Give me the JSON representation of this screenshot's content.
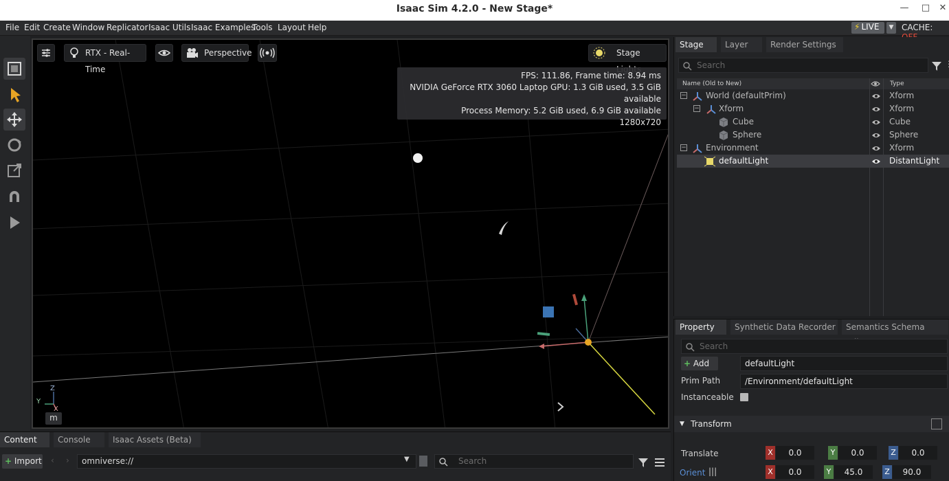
{
  "window": {
    "title": "Isaac Sim 4.2.0 - New Stage*",
    "minimize_glyph": "—",
    "maximize_glyph": "□",
    "close_glyph": "✕"
  },
  "menu": [
    "File",
    "Edit",
    "Create",
    "Window",
    "Replicator",
    "Isaac Utils",
    "Isaac Examples",
    "Tools",
    "Layout",
    "Help"
  ],
  "live": {
    "label": "LIVE",
    "cache_label": "CACHE:",
    "cache_state": "OFF"
  },
  "viewport": {
    "renderer_label": "RTX - Real-Time",
    "camera_label": "Perspective",
    "lights_label": "Stage Lights",
    "stats": [
      "FPS: 111.86, Frame time: 8.94 ms",
      "NVIDIA GeForce RTX 3060 Laptop GPU: 1.3 GiB used, 3.5 GiB available",
      "Process Memory: 5.2 GiB used, 6.9 GiB available",
      "1280x720"
    ],
    "axis_labels": {
      "z": "Z",
      "y": "Y",
      "x": "X"
    },
    "unit_button": "m"
  },
  "content": {
    "tabs": [
      "Content",
      "Console",
      "Isaac Assets (Beta)"
    ],
    "import_label": "Import",
    "path_value": "omniverse://",
    "search_placeholder": "Search"
  },
  "stage": {
    "tabs": [
      "Stage",
      "Layer",
      "Render Settings"
    ],
    "search_placeholder": "Search",
    "columns": {
      "name": "Name (Old to New)",
      "type": "Type"
    },
    "rows": [
      {
        "name": "World (defaultPrim)",
        "type": "Xform",
        "icon": "xform-icon"
      },
      {
        "name": "Xform",
        "type": "Xform",
        "icon": "xform-icon"
      },
      {
        "name": "Cube",
        "type": "Cube",
        "icon": "cube-icon"
      },
      {
        "name": "Sphere",
        "type": "Sphere",
        "icon": "sphere-icon"
      },
      {
        "name": "Environment",
        "type": "Xform",
        "icon": "xform-icon"
      },
      {
        "name": "defaultLight",
        "type": "DistantLight",
        "icon": "light-icon"
      }
    ]
  },
  "property": {
    "tabs": [
      "Property",
      "Synthetic Data Recorder",
      "Semantics Schema Editor"
    ],
    "search_placeholder": "Search",
    "add_label": "Add",
    "name_value": "defaultLight",
    "prim_path_label": "Prim Path",
    "prim_path_value": "/Environment/defaultLight",
    "instanceable_label": "Instanceable",
    "transform_label": "Transform",
    "translate_label": "Translate",
    "translate": {
      "x": "0.0",
      "y": "0.0",
      "z": "0.0"
    },
    "orient_label": "Orient",
    "orient": {
      "x": "0.0",
      "y": "45.0",
      "z": "90.0"
    },
    "axis_letters": {
      "x": "X",
      "y": "Y",
      "z": "Z"
    }
  },
  "colors": {
    "accent_live": "#f5d22b",
    "cache_off": "#e04a3a",
    "selection_accent": "#5a8fd6",
    "axis_x": "#a0302b",
    "axis_y": "#4b7d44",
    "axis_z": "#3b5c8f"
  }
}
